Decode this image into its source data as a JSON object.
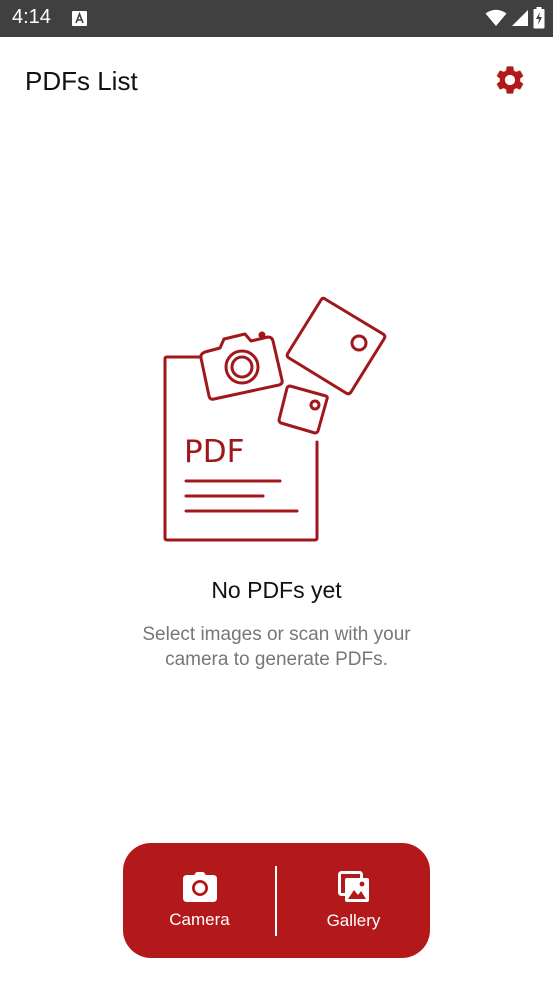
{
  "status_bar": {
    "time": "4:14",
    "icons": [
      "notification-a-icon",
      "wifi-icon",
      "signal-icon",
      "battery-charging-icon"
    ]
  },
  "header": {
    "title": "PDFs List",
    "settings_icon": "gear-icon"
  },
  "empty_state": {
    "illustration_text": "PDF",
    "title": "No PDFs yet",
    "subtitle": "Select images or scan with your camera to generate PDFs."
  },
  "actions": {
    "camera_label": "Camera",
    "gallery_label": "Gallery"
  },
  "colors": {
    "accent": "#b3191b",
    "status_bar": "#404040",
    "title_text": "#111111",
    "subtitle_text": "#777777"
  }
}
